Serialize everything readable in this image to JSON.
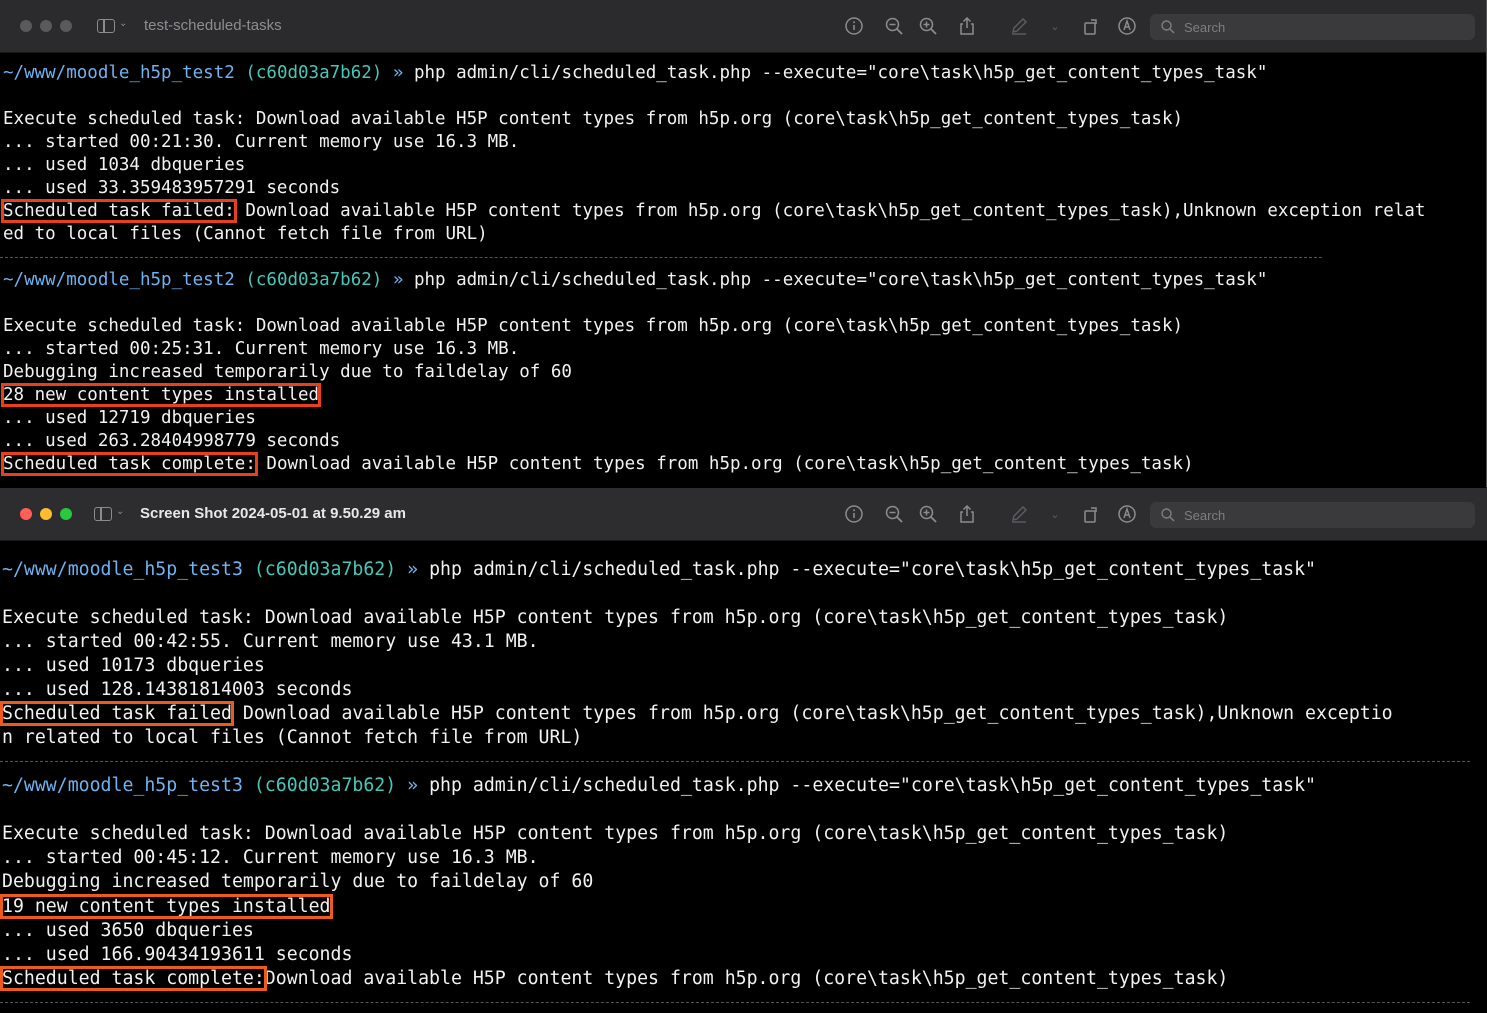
{
  "window1": {
    "title": "test-scheduled-tasks",
    "search_placeholder": "Search",
    "lines": [
      {
        "path": "~/www/moodle_h5p_test2",
        "hash": "(c60d03a7b62)",
        "arrow": "»",
        "cmd": "php admin/cli/scheduled_task.php --execute=\"core\\task\\h5p_get_content_types_task\""
      },
      {
        "text": "Execute scheduled task: Download available H5P content types from h5p.org (core\\task\\h5p_get_content_types_task)"
      },
      {
        "text": "... started 00:21:30. Current memory use 16.3 MB."
      },
      {
        "text": "... used 1034 dbqueries"
      },
      {
        "text": "... used 33.359483957291 seconds"
      },
      {
        "label": "Scheduled task failed:",
        "rest": " Download available H5P content types from h5p.org (core\\task\\h5p_get_content_types_task),Unknown exception relat"
      },
      {
        "text": "ed to local files (Cannot fetch file from URL)"
      },
      {
        "path": "~/www/moodle_h5p_test2",
        "hash": "(c60d03a7b62)",
        "arrow": "»",
        "cmd": "php admin/cli/scheduled_task.php --execute=\"core\\task\\h5p_get_content_types_task\""
      },
      {
        "text": "Execute scheduled task: Download available H5P content types from h5p.org (core\\task\\h5p_get_content_types_task)"
      },
      {
        "text": "... started 00:25:31. Current memory use 16.3 MB."
      },
      {
        "text": "Debugging increased temporarily due to faildelay of 60"
      },
      {
        "label": "28 new content types installed"
      },
      {
        "text": "... used 12719 dbqueries"
      },
      {
        "text": "... used 263.28404998779 seconds"
      },
      {
        "label": "Scheduled task complete:",
        "rest": " Download available H5P content types from h5p.org (core\\task\\h5p_get_content_types_task)"
      }
    ]
  },
  "window2": {
    "title": "Screen Shot 2024-05-01 at 9.50.29 am",
    "search_placeholder": "Search",
    "lines": [
      {
        "path": "~/www/moodle_h5p_test3",
        "hash": "(c60d03a7b62)",
        "arrow": "»",
        "cmd": "php admin/cli/scheduled_task.php --execute=\"core\\task\\h5p_get_content_types_task\""
      },
      {
        "text": "Execute scheduled task: Download available H5P content types from h5p.org (core\\task\\h5p_get_content_types_task)"
      },
      {
        "text": "... started 00:42:55. Current memory use 43.1 MB."
      },
      {
        "text": "... used 10173 dbqueries"
      },
      {
        "text": "... used 128.14381814003 seconds"
      },
      {
        "label": "Scheduled task failed",
        "rest": " Download available H5P content types from h5p.org (core\\task\\h5p_get_content_types_task),Unknown exceptio"
      },
      {
        "text": "n related to local files (Cannot fetch file from URL)"
      },
      {
        "path": "~/www/moodle_h5p_test3",
        "hash": "(c60d03a7b62)",
        "arrow": "»",
        "cmd": "php admin/cli/scheduled_task.php --execute=\"core\\task\\h5p_get_content_types_task\""
      },
      {
        "text": "Execute scheduled task: Download available H5P content types from h5p.org (core\\task\\h5p_get_content_types_task)"
      },
      {
        "text": "... started 00:45:12. Current memory use 16.3 MB."
      },
      {
        "text": "Debugging increased temporarily due to faildelay of 60"
      },
      {
        "label": "19 new content types installed"
      },
      {
        "text": "... used 3650 dbqueries"
      },
      {
        "text": "... used 166.90434193611 seconds"
      },
      {
        "label": "Scheduled task complete:",
        "rest": "Download available H5P content types from h5p.org (core\\task\\h5p_get_content_types_task)"
      }
    ]
  },
  "colors": {
    "path": "#6fb3f0",
    "hash": "#48c7b8",
    "highlight_box": "#e8401c"
  },
  "toolbar_icons": [
    "sidebar-icon",
    "info-icon",
    "zoom-out-icon",
    "zoom-in-icon",
    "share-icon",
    "markup-pen-icon",
    "chevron-down-icon",
    "rotate-icon",
    "markup-circle-icon",
    "search-icon"
  ]
}
